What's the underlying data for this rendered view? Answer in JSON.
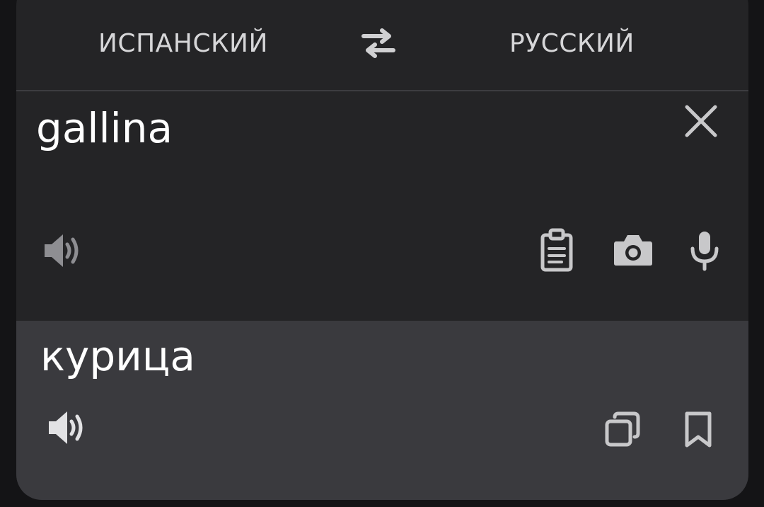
{
  "languages": {
    "source": "ИСПАНСКИЙ",
    "target": "РУССКИЙ"
  },
  "input": {
    "text": "gallina"
  },
  "output": {
    "text": "курица"
  },
  "icons": {
    "swap": "swap-arrows-icon",
    "clear": "close-icon",
    "speak_source": "speaker-icon",
    "paste": "clipboard-icon",
    "camera": "camera-icon",
    "mic": "microphone-icon",
    "speak_target": "speaker-icon",
    "copy": "copy-icon",
    "save": "bookmark-icon"
  },
  "colors": {
    "background": "#141416",
    "card": "#242426",
    "output_panel": "#3a3a3e",
    "text": "#ffffff",
    "icon": "#c8c8ca",
    "icon_dim": "#8e8e92"
  }
}
